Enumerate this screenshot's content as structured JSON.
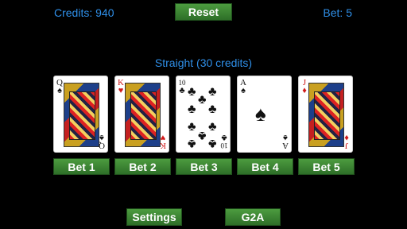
{
  "header": {
    "credits_text": "Credits: 940",
    "reset_label": "Reset",
    "bet_text": "Bet: 5"
  },
  "result_text": "Straight (30 credits)",
  "cards": [
    {
      "rank": "Q",
      "suit": "♠",
      "color": "black",
      "kind": "face"
    },
    {
      "rank": "K",
      "suit": "♥",
      "color": "red",
      "kind": "face"
    },
    {
      "rank": "10",
      "suit": "♣",
      "color": "black",
      "kind": "pips"
    },
    {
      "rank": "A",
      "suit": "♠",
      "color": "black",
      "kind": "ace"
    },
    {
      "rank": "J",
      "suit": "♦",
      "color": "red",
      "kind": "face"
    }
  ],
  "bet_buttons": [
    "Bet 1",
    "Bet 2",
    "Bet 3",
    "Bet 4",
    "Bet 5"
  ],
  "footer": {
    "settings_label": "Settings",
    "g2a_label": "G2A"
  },
  "colors": {
    "background": "#000000",
    "text_accent": "#2f8fe8",
    "button_green": "#3d8a34",
    "suit_red": "#d01a1a"
  }
}
